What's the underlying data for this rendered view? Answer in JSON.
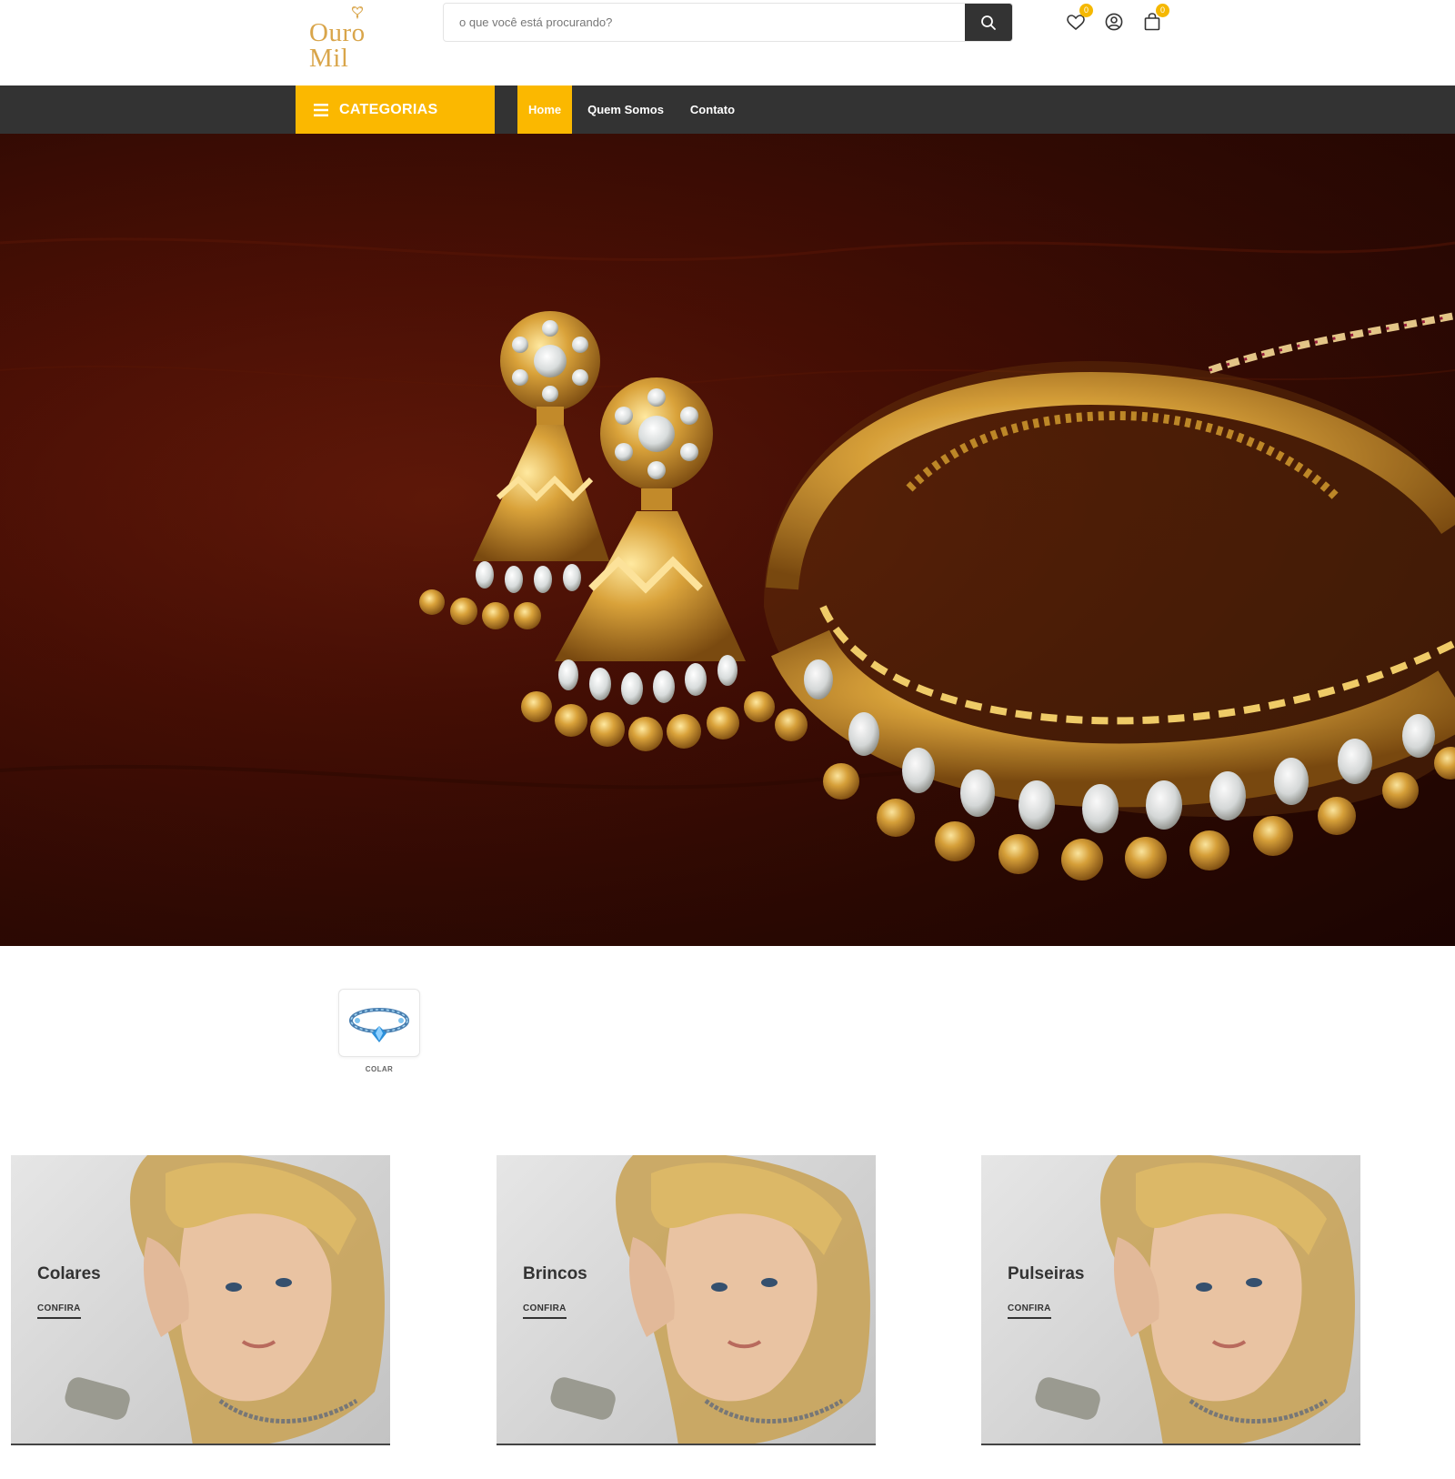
{
  "brand": {
    "name": "Ouro Mil",
    "color": "#d9a54a"
  },
  "search": {
    "placeholder": "o que você está procurando?",
    "value": ""
  },
  "header_icons": {
    "wishlist": {
      "icon": "heart-icon",
      "count": "0"
    },
    "account": {
      "icon": "user-icon"
    },
    "cart": {
      "icon": "cart-icon",
      "count": "0"
    }
  },
  "nav": {
    "categories_label": "CATEGORIAS",
    "links": [
      {
        "label": "Home",
        "active": true
      },
      {
        "label": "Quem Somos",
        "active": false
      },
      {
        "label": "Contato",
        "active": false
      }
    ]
  },
  "category_thumbs": [
    {
      "label": "COLAR",
      "icon": "bracelet-icon"
    }
  ],
  "banners": [
    {
      "title": "Colares",
      "link": "CONFIRA"
    },
    {
      "title": "Brincos",
      "link": "CONFIRA"
    },
    {
      "title": "Pulseiras",
      "link": "CONFIRA"
    }
  ],
  "colors": {
    "accent": "#fbb800",
    "nav_bg": "#333333",
    "text": "#333333"
  }
}
